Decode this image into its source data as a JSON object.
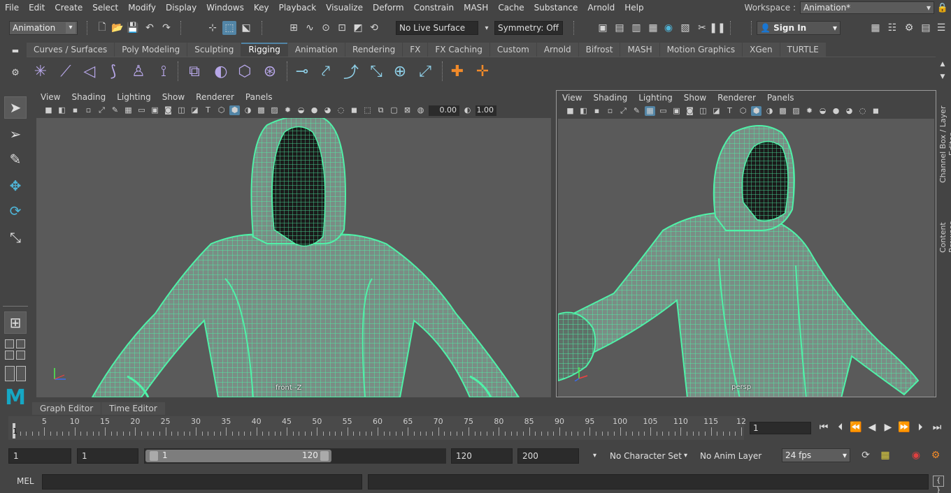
{
  "menu": [
    "File",
    "Edit",
    "Create",
    "Select",
    "Modify",
    "Display",
    "Windows",
    "Key",
    "Playback",
    "Visualize",
    "Deform",
    "Constrain",
    "MASH",
    "Cache",
    "Substance",
    "Arnold",
    "Help"
  ],
  "workspace": {
    "label": "Workspace :",
    "value": "Animation*"
  },
  "status": {
    "mode": "Animation",
    "live_surface": "No Live Surface",
    "symmetry": "Symmetry: Off",
    "sign_in": "Sign In"
  },
  "shelf_tabs": [
    "Curves / Surfaces",
    "Poly Modeling",
    "Sculpting",
    "Rigging",
    "Animation",
    "Rendering",
    "FX",
    "FX Caching",
    "Custom",
    "Arnold",
    "Bifrost",
    "MASH",
    "Motion Graphics",
    "XGen",
    "TURTLE"
  ],
  "shelf_active": "Rigging",
  "panels": {
    "menu": [
      "View",
      "Shading",
      "Lighting",
      "Show",
      "Renderer",
      "Panels"
    ],
    "left": {
      "field1": "0.00",
      "field2": "1.00",
      "camera": "front -Z"
    },
    "right": {
      "camera": "persp"
    }
  },
  "side_tabs": {
    "channel": "Channel Box / Layer Editor",
    "content": "Content Browser"
  },
  "editor_tabs": [
    "Graph Editor",
    "Time Editor"
  ],
  "timeline": {
    "ticks": [
      5,
      10,
      15,
      20,
      25,
      30,
      35,
      40,
      45,
      50,
      55,
      60,
      65,
      70,
      75,
      80,
      85,
      90,
      95,
      100,
      105,
      110,
      115,
      12
    ],
    "current_label": "1",
    "current_frame": "1"
  },
  "range": {
    "start": "1",
    "anim_start": "1",
    "range_min": "1",
    "range_max": "120",
    "anim_end": "120",
    "end": "200",
    "character_set": "No Character Set",
    "anim_layer": "No Anim Layer",
    "fps": "24 fps"
  },
  "command": {
    "label": "MEL"
  },
  "colors": {
    "wire": "#4ff2a8",
    "accent": "#5285a6",
    "logo": "#16a7c4"
  }
}
